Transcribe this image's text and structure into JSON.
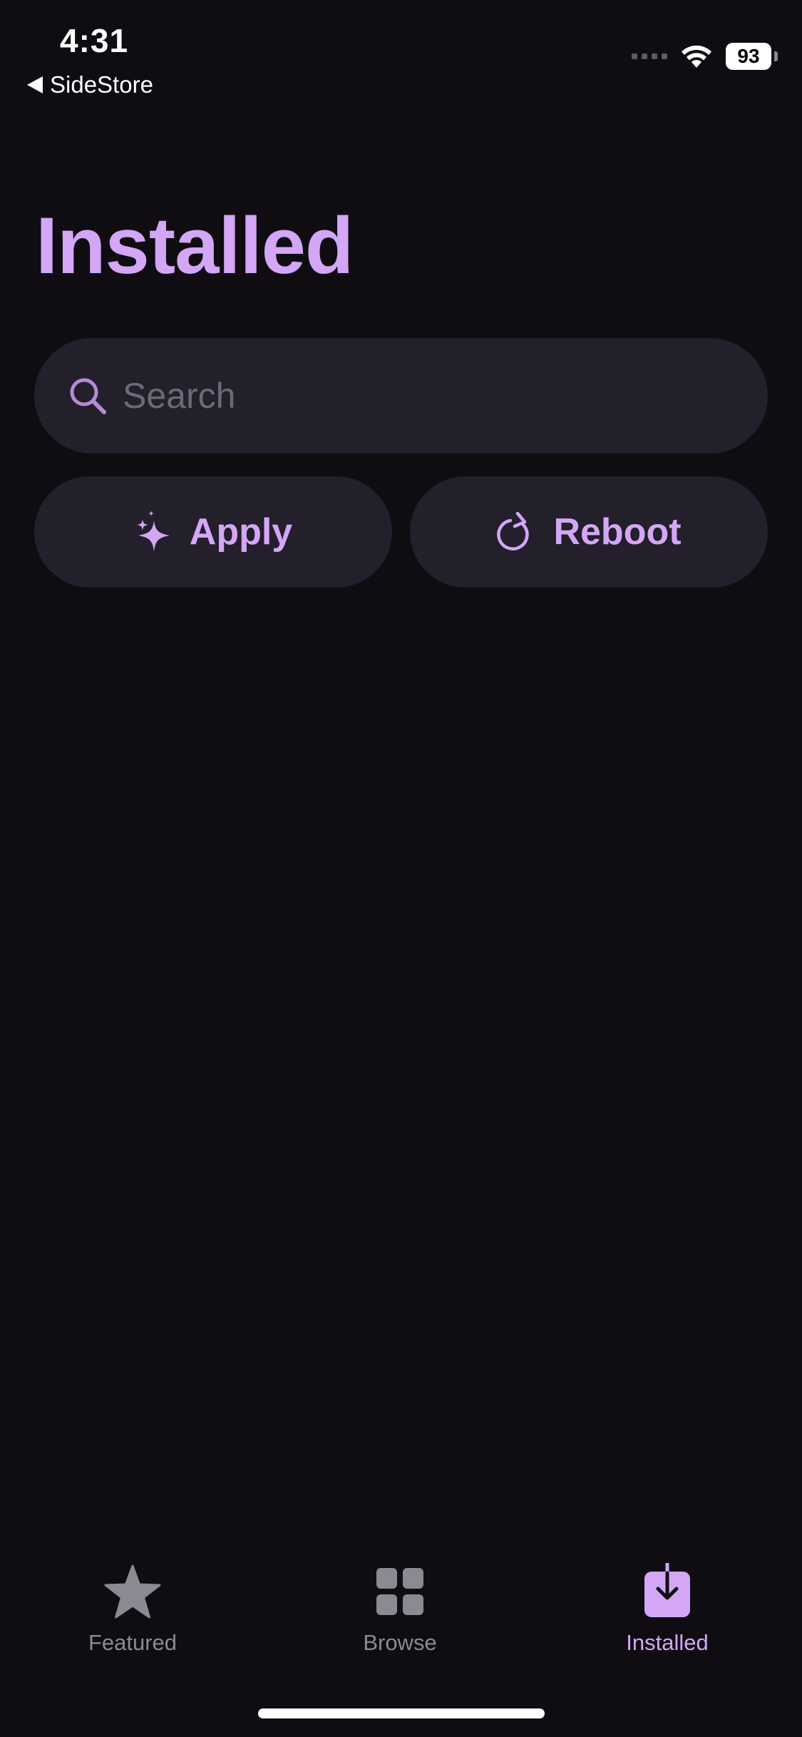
{
  "status_bar": {
    "time": "4:31",
    "back_app": "SideStore",
    "battery": "93"
  },
  "header": {
    "title": "Installed"
  },
  "search": {
    "placeholder": "Search",
    "value": ""
  },
  "actions": {
    "apply_label": "Apply",
    "reboot_label": "Reboot"
  },
  "tabbar": {
    "items": [
      {
        "label": "Featured",
        "icon": "star-icon",
        "active": false
      },
      {
        "label": "Browse",
        "icon": "grid-icon",
        "active": false
      },
      {
        "label": "Installed",
        "icon": "download-tray-icon",
        "active": true
      }
    ]
  },
  "colors": {
    "background": "#0f0d12",
    "accent": "#d4a6f6",
    "surface": "#231f2b",
    "inactive": "#8c8992"
  }
}
